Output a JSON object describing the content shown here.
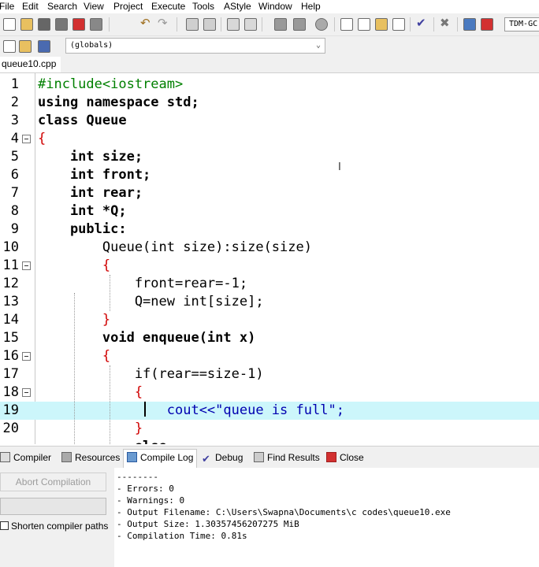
{
  "menu": [
    "File",
    "Edit",
    "Search",
    "View",
    "Project",
    "Execute",
    "Tools",
    "AStyle",
    "Window",
    "Help"
  ],
  "toolbar": {
    "compiler_select": "TDM-GC"
  },
  "scope_dropdown": {
    "value": "(globals)"
  },
  "file_tab": "queue10.cpp",
  "editor": {
    "line_numbers": [
      "1",
      "2",
      "3",
      "4",
      "5",
      "6",
      "7",
      "8",
      "9",
      "10",
      "11",
      "12",
      "13",
      "14",
      "15",
      "16",
      "17",
      "18",
      "19",
      "20"
    ],
    "lines": [
      "#include<iostream>",
      "using namespace std;",
      "class Queue",
      "{",
      "    int size;",
      "    int front;",
      "    int rear;",
      "    int *Q;",
      "    public:",
      "        Queue(int size):size(size)",
      "        {",
      "            front=rear=-1;",
      "            Q=new int[size];",
      "        }",
      "        void enqueue(int x)",
      "        {",
      "            if(rear==size-1)",
      "            {",
      "                cout<<\"queue is full\";",
      "            }"
    ],
    "partial_line": "            else",
    "current_line": 19
  },
  "bottom_tabs": [
    "Compiler",
    "Resources",
    "Compile Log",
    "Debug",
    "Find Results",
    "Close"
  ],
  "active_bottom_tab": "Compile Log",
  "compile_panel": {
    "abort_label": "Abort Compilation",
    "shorten_paths_label": "Shorten compiler paths",
    "shorten_paths_checked": false
  },
  "compile_log": [
    "--------",
    "- Errors: 0",
    "- Warnings: 0",
    "- Output Filename: C:\\Users\\Swapna\\Documents\\c codes\\queue10.exe",
    "- Output Size: 1.30357456207275 MiB",
    "- Compilation Time: 0.81s"
  ],
  "colors": {
    "keyword": "#000000",
    "symbol": "#d00000",
    "number": "#6a00d0",
    "string": "#0000b0",
    "preprocessor": "#008000",
    "current_line_bg": "#ccf6fb"
  },
  "icons": [
    "new-file-icon",
    "open-icon",
    "save-icon",
    "save-all-icon",
    "close-file-icon",
    "print-icon",
    "undo-icon",
    "redo-icon",
    "find-icon",
    "replace-icon",
    "goto-icon",
    "indent-icon",
    "compile-icon",
    "run-icon",
    "compile-run-icon",
    "rebuild-icon",
    "check-icon",
    "stop-icon",
    "chart-icon",
    "profile-icon",
    "project-new-icon",
    "project-add-icon",
    "project-remove-icon"
  ]
}
